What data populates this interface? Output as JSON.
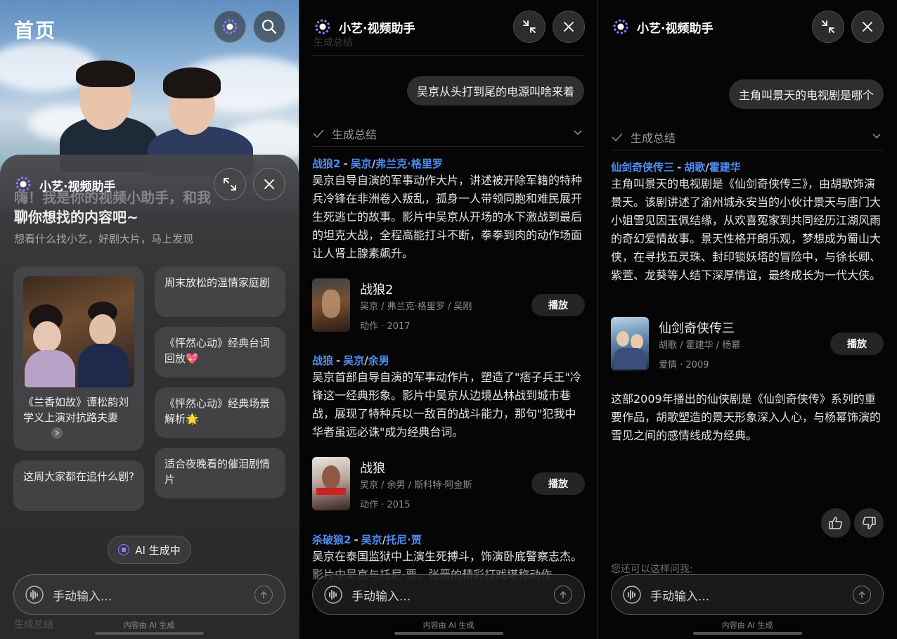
{
  "panel1": {
    "page_title": "首页",
    "assistant_title": "小艺·视频助手",
    "greeting_ghost": "嗨！我是你的视频小助手，和我聊",
    "greeting": "聊你想找的内容吧~",
    "subtitle": "想看什么找小艺，好剧大片，马上发现",
    "cards": {
      "featured": "《兰香如故》谭松韵刘学义上演对抗路夫妻",
      "weekend": "周末放松的温情家庭剧",
      "quotes": "《怦然心动》经典台词回放💖",
      "scenes": "《怦然心动》经典场景解析🌟",
      "trending": "这周大家都在追什么剧?",
      "tearjerker": "适合夜晚看的催泪剧情片"
    },
    "ai_status": "AI 生成中",
    "input_placeholder": "手动输入...",
    "footer": "内容由 AI 生成",
    "behind_summary": "生成总结"
  },
  "panel2": {
    "title": "小艺·视频助手",
    "ghost_summary": "生成总结",
    "user_query": "吴京从头打到尾的电源叫啥来着",
    "summary_label": "生成总结",
    "entries": [
      {
        "title": "战狼2",
        "people": [
          "吴京",
          "弗兰克·格里罗"
        ],
        "text": "吴京自导自演的军事动作大片，讲述被开除军籍的特种兵冷锋在非洲卷入叛乱，孤身一人带领同胞和难民展开生死逃亡的故事。影片中吴京从开场的水下激战到最后的坦克大战，全程高能打斗不断，拳拳到肉的动作场面让人肾上腺素飙升。",
        "media_title": "战狼2",
        "cast": "吴京 / 弗兰克·格里罗 / 吴刚",
        "meta": "动作 · 2017",
        "play": "播放"
      },
      {
        "title": "战狼",
        "people": [
          "吴京",
          "余男"
        ],
        "text": "吴京首部自导自演的军事动作片，塑造了\"痞子兵王\"冷锋这一经典形象。影片中吴京从边境丛林战到城市巷战，展现了特种兵以一敌百的战斗能力，那句\"犯我中华者虽远必诛\"成为经典台词。",
        "media_title": "战狼",
        "cast": "吴京 / 余男 / 斯科特·阿金斯",
        "meta": "动作 · 2015",
        "play": "播放"
      },
      {
        "title": "杀破狼2",
        "people": [
          "吴京",
          "托尼·贾"
        ],
        "text": "吴京在泰国监狱中上演生死搏斗，饰演卧底警察志杰。影片中吴京与托尼·贾、张晋的精彩打戏堪称动作"
      }
    ],
    "input_placeholder": "手动输入...",
    "footer": "内容由 AI 生成"
  },
  "panel3": {
    "title": "小艺·视频助手",
    "user_query": "主角叫景天的电视剧是哪个",
    "summary_label": "生成总结",
    "entry": {
      "title": "仙剑奇侠传三",
      "people": [
        "胡歌",
        "霍建华"
      ],
      "text": "主角叫景天的电视剧是《仙剑奇侠传三》，由胡歌饰演景天。该剧讲述了渝州城永安当的小伙计景天与唐门大小姐雪见因玉佩结缘，从欢喜冤家到共同经历江湖风雨的奇幻爱情故事。景天性格开朗乐观，梦想成为蜀山大侠，在寻找五灵珠、封印锁妖塔的冒险中，与徐长卿、紫萱、龙葵等人结下深厚情谊，最终成长为一代大侠。",
      "media_title": "仙剑奇侠传三",
      "cast": "胡歌 / 霍建华 / 杨幂",
      "meta": "爱情 · 2009",
      "play": "播放"
    },
    "closing_text": "这部2009年播出的仙侠剧是《仙剑奇侠传》系列的重要作品，胡歌塑造的景天形象深入人心，与杨幂饰演的雪见之间的感情线成为经典。",
    "hint": "您还可以这样问我:",
    "input_placeholder": "手动输入...",
    "footer": "内容由 AI 生成"
  }
}
